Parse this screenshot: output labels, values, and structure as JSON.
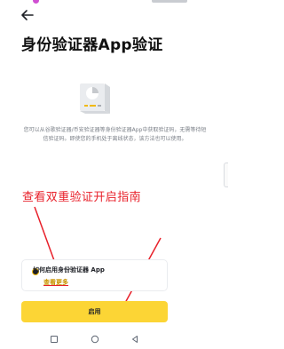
{
  "header": {
    "back_icon": "arrow-left-icon",
    "title": "身份验证器App验证"
  },
  "hero": {
    "icon": "authenticator-app-icon",
    "description": "您可以从谷歌验证器/币安验证器等身份验证器App中获取验证码，无需等待短信验证码。即使您的手机处于离线状态，该方法也可以使用。"
  },
  "annotation": {
    "note": "查看双重验证开启指南",
    "color": "#e8202a"
  },
  "promo": {
    "icon": "authenticator-badge-icon",
    "title": "如何启用身份验证器 App",
    "link": "查看更多"
  },
  "actions": {
    "enable_label": "启用",
    "accent": "#fcd535"
  },
  "system_nav": {
    "recents_icon": "square-icon",
    "home_icon": "circle-icon",
    "back_icon": "triangle-back-icon"
  }
}
